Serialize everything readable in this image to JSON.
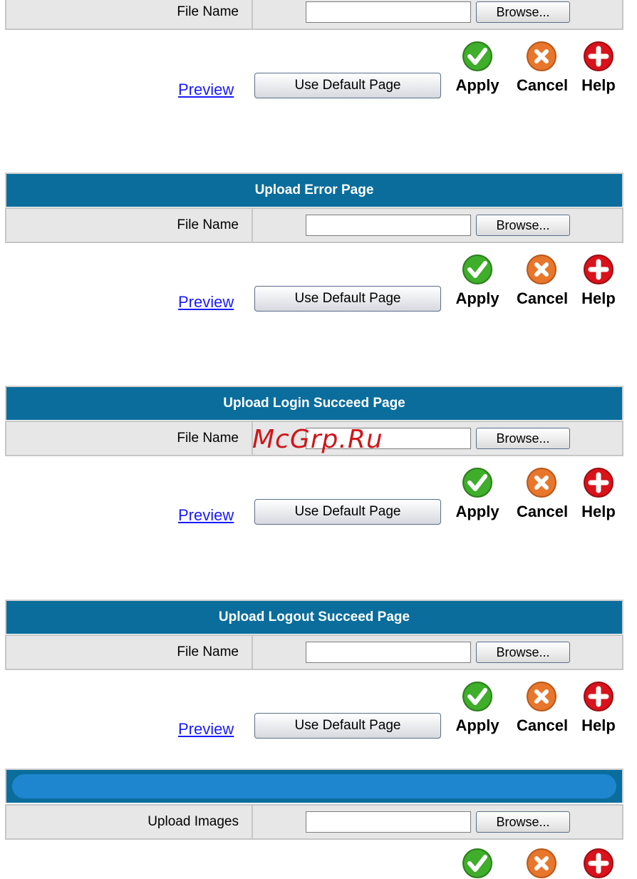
{
  "labels": {
    "file_name": "File Name",
    "upload_images": "Upload Images",
    "browse": "Browse...",
    "preview": "Preview",
    "use_default": "Use Default Page",
    "apply": "Apply",
    "cancel": "Cancel",
    "help": "Help"
  },
  "sections": {
    "error": {
      "title": "Upload Error Page"
    },
    "login": {
      "title": "Upload Login Succeed Page"
    },
    "logout": {
      "title": "Upload Logout Succeed Page"
    }
  },
  "watermark": "McGrp.Ru",
  "colors": {
    "header_bg": "#0a6d9c",
    "row_bg": "#e7e7e7",
    "link": "#1a1aff",
    "apply": "#3fae2a",
    "cancel": "#e8762b",
    "help": "#d9121b"
  },
  "icons": [
    "check-icon",
    "x-icon",
    "plus-icon"
  ]
}
